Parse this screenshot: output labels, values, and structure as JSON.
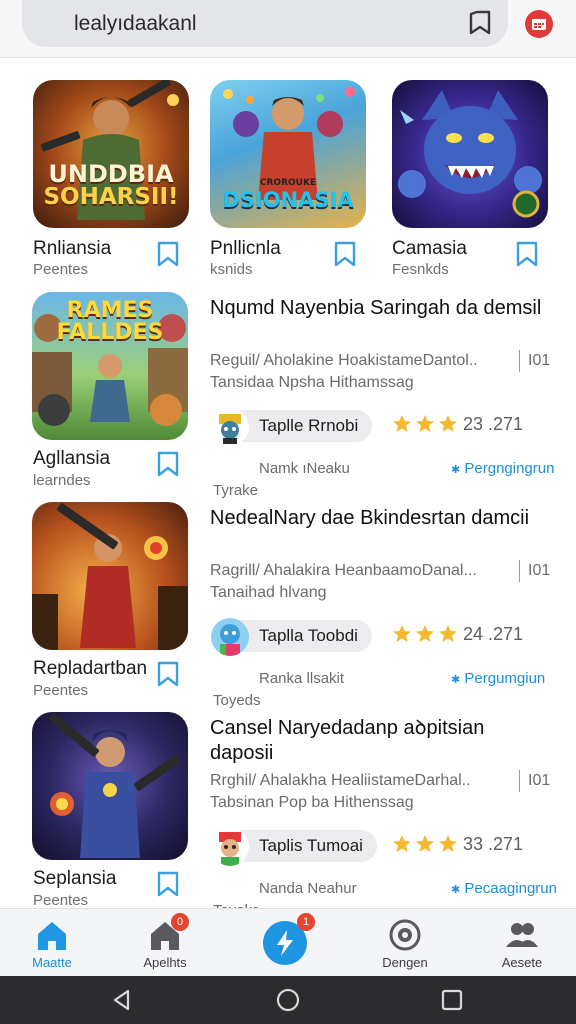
{
  "search": {
    "query": "lealyıdaakanl"
  },
  "top_apps": [
    {
      "title": "Rnliansia",
      "subtitle": "Peentes",
      "art_text": [
        "UNDDBIA",
        "SOHARSII!"
      ]
    },
    {
      "title": "Pnllicnla",
      "subtitle": "ksnids",
      "art_text": [
        "CROROUKE",
        "DSIONASIA"
      ]
    },
    {
      "title": "Camasia",
      "subtitle": "Fesnkds",
      "art_text": []
    }
  ],
  "list": [
    {
      "app_title": "Agllansia",
      "app_subtitle": "learndes",
      "art_text": [
        "RAMES",
        "FALLDES"
      ],
      "headline": "Nqumd Nayenbia Saringah da demsil",
      "desc1": "Reguil/ Aholakine HoakistameDantol..",
      "desc2": "Tansidaa Npsha Hithamssag",
      "number": "I01",
      "chip": "Taplle Rrnobi",
      "score": "23 .271",
      "meta1": "Namk ıNeaku",
      "link": "Pergngingrun",
      "meta2": "Tyrake",
      "stars": 3
    },
    {
      "app_title": "Repladartban",
      "app_subtitle": "Peentes",
      "art_text": [],
      "headline": "NedealNary dae Bkindesrtan damcii",
      "desc1": "Ragrill/ Ahalakira HeanbaamoDanal...",
      "desc2": "Tanaihad hlvang",
      "number": "I01",
      "chip": "Taplla Toobdi",
      "score": "24 .271",
      "meta1": "Ranka llsakit",
      "link": "Pergumgiun",
      "meta2": "Toyeds",
      "stars": 3
    },
    {
      "app_title": "Seplansia",
      "app_subtitle": "Peentes",
      "art_text": [],
      "headline": "Cansel Naryedadanp aꝺpitsian daposii",
      "desc1": "Rrghil/ Ahalakha HealiistameDarhal..",
      "desc2": "Tabsinan Pop ba Hithenssag",
      "number": "I01",
      "chip": "Taplis Tumoai",
      "score": "33 .271",
      "meta1": "Nanda Neahur",
      "link": "Pecaagingrun",
      "meta2": "Toyaks",
      "stars": 3
    }
  ],
  "nav": [
    {
      "label": "Maatte",
      "icon": "home-icon",
      "active": true
    },
    {
      "label": "Apelhts",
      "icon": "apps-icon",
      "badge": "0"
    },
    {
      "label": "",
      "icon": "lightning-icon",
      "badge": "1"
    },
    {
      "label": "Dengen",
      "icon": "settings-icon"
    },
    {
      "label": "Aesete",
      "icon": "people-icon"
    }
  ],
  "colors": {
    "accent": "#1d8fd6",
    "star": "#f5b82e",
    "notif": "#e03b3b"
  }
}
